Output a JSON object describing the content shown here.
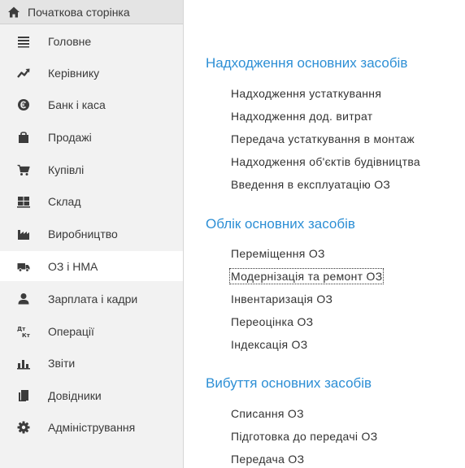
{
  "sidebar": {
    "home_label": "Початкова сторінка",
    "items": [
      {
        "label": "Головне",
        "icon": "menu-lines-icon"
      },
      {
        "label": "Керівнику",
        "icon": "trend-chart-icon"
      },
      {
        "label": "Банк і каса",
        "icon": "coin-icon"
      },
      {
        "label": "Продажі",
        "icon": "shopping-bag-icon"
      },
      {
        "label": "Купівлі",
        "icon": "shopping-cart-icon"
      },
      {
        "label": "Склад",
        "icon": "warehouse-grid-icon"
      },
      {
        "label": "Виробництво",
        "icon": "factory-icon"
      },
      {
        "label": "ОЗ і НМА",
        "icon": "truck-icon",
        "active": true
      },
      {
        "label": "Зарплата і кадри",
        "icon": "person-icon"
      },
      {
        "label": "Операції",
        "icon": "debit-credit-icon"
      },
      {
        "label": "Звіти",
        "icon": "bar-chart-icon"
      },
      {
        "label": "Довідники",
        "icon": "book-icon"
      },
      {
        "label": "Адміністрування",
        "icon": "gear-icon"
      }
    ]
  },
  "sections": [
    {
      "title": "Надходження основних засобів",
      "links": [
        "Надходження устаткування",
        "Надходження дод. витрат",
        "Передача устаткування в монтаж",
        "Надходження об'єктів будівництва",
        "Введення в експлуатацію ОЗ"
      ]
    },
    {
      "title": "Облік основних засобів",
      "links": [
        "Переміщення ОЗ",
        "Модернізація та ремонт ОЗ",
        "Інвентаризація ОЗ",
        "Переоцінка ОЗ",
        "Індексація ОЗ"
      ]
    },
    {
      "title": "Вибуття основних засобів",
      "links": [
        "Списання ОЗ",
        "Підготовка до передачі ОЗ",
        "Передача ОЗ"
      ]
    }
  ],
  "colors": {
    "accent": "#2d8fd5",
    "sidebar_bg": "#f2f2f2",
    "home_bg": "#e4e4e4",
    "active_bg": "#ffffff",
    "icon": "#3c3c3c"
  }
}
